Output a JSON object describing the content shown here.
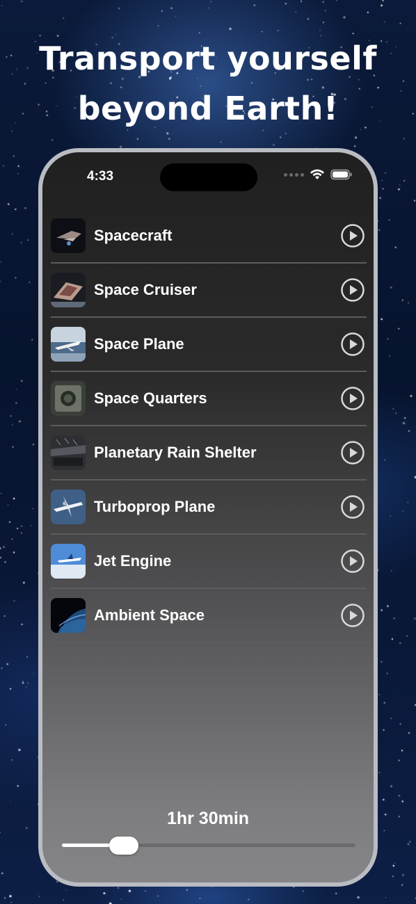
{
  "headline": {
    "line1": "Transport yourself",
    "line2": "beyond Earth!"
  },
  "status_bar": {
    "time": "4:33"
  },
  "sounds": [
    {
      "label": "Spacecraft",
      "thumb": "spacecraft"
    },
    {
      "label": "Space Cruiser",
      "thumb": "cruiser"
    },
    {
      "label": "Space Plane",
      "thumb": "plane"
    },
    {
      "label": "Space Quarters",
      "thumb": "quarters"
    },
    {
      "label": "Planetary Rain Shelter",
      "thumb": "shelter"
    },
    {
      "label": "Turboprop Plane",
      "thumb": "turboprop"
    },
    {
      "label": "Jet Engine",
      "thumb": "jet"
    },
    {
      "label": "Ambient Space",
      "thumb": "earth"
    }
  ],
  "timer": {
    "label": "1hr 30min",
    "slider_fraction": 0.18
  },
  "colors": {
    "accent": "#ffffff",
    "separator": "#5d5d5f"
  }
}
